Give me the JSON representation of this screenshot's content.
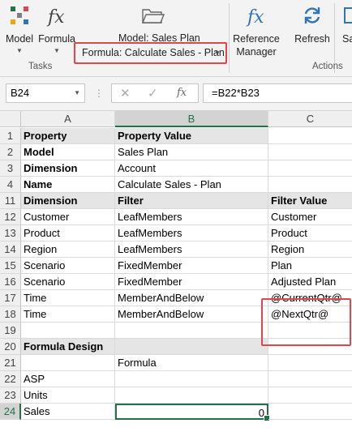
{
  "ribbon": {
    "model_label": "Model",
    "formula_label": "Formula",
    "model_name": "Model: Sales Plan",
    "formula_dropdown": "Formula: Calculate Sales - Plan",
    "reference_manager_line1": "Reference",
    "reference_manager_line2": "Manager",
    "refresh_label": "Refresh",
    "cut_label": "Sa",
    "group_tasks": "Tasks",
    "group_actions": "Actions",
    "colors": {
      "accent_green": "#217346",
      "highlight_red": "#e0474c",
      "icon_blue": "#2e75b6"
    }
  },
  "formula_bar": {
    "name_box": "B24",
    "fx_symbol": "fx",
    "formula": "=B22*B23"
  },
  "columns": [
    "A",
    "B",
    "C"
  ],
  "rows": [
    {
      "num": "1",
      "a": "Property",
      "b": "Property Value",
      "c": "",
      "style": "header"
    },
    {
      "num": "2",
      "a": "Model",
      "b": "Sales Plan",
      "c": "",
      "style": "label"
    },
    {
      "num": "3",
      "a": "Dimension",
      "b": "Account",
      "c": "",
      "style": "label"
    },
    {
      "num": "4",
      "a": "Name",
      "b": "Calculate Sales - Plan",
      "c": "",
      "style": "label"
    },
    {
      "num": "11",
      "a": "Dimension",
      "b": "Filter",
      "c": "Filter Value",
      "style": "header"
    },
    {
      "num": "12",
      "a": "Customer",
      "b": "LeafMembers",
      "c": "Customer",
      "style": "plain"
    },
    {
      "num": "13",
      "a": "Product",
      "b": "LeafMembers",
      "c": "Product",
      "style": "plain"
    },
    {
      "num": "14",
      "a": "Region",
      "b": "LeafMembers",
      "c": "Region",
      "style": "plain"
    },
    {
      "num": "15",
      "a": "Scenario",
      "b": "FixedMember",
      "c": "Plan",
      "style": "plain"
    },
    {
      "num": "16",
      "a": "Scenario",
      "b": "FixedMember",
      "c": "Adjusted Plan",
      "style": "plain"
    },
    {
      "num": "17",
      "a": "Time",
      "b": "MemberAndBelow",
      "c": "@CurrentQtr@",
      "style": "plain"
    },
    {
      "num": "18",
      "a": "Time",
      "b": "MemberAndBelow",
      "c": "@NextQtr@",
      "style": "plain"
    },
    {
      "num": "19",
      "a": "",
      "b": "",
      "c": "",
      "style": "plain"
    },
    {
      "num": "20",
      "a": "Formula Design",
      "b": "",
      "c": "",
      "style": "header"
    },
    {
      "num": "21",
      "a": "",
      "b": "Formula",
      "c": "",
      "style": "plain"
    },
    {
      "num": "22",
      "a": "ASP",
      "b": "",
      "c": "",
      "style": "plain"
    },
    {
      "num": "23",
      "a": "Units",
      "b": "",
      "c": "",
      "style": "plain"
    },
    {
      "num": "24",
      "a": "Sales",
      "b": "0",
      "c": "",
      "style": "active"
    }
  ]
}
